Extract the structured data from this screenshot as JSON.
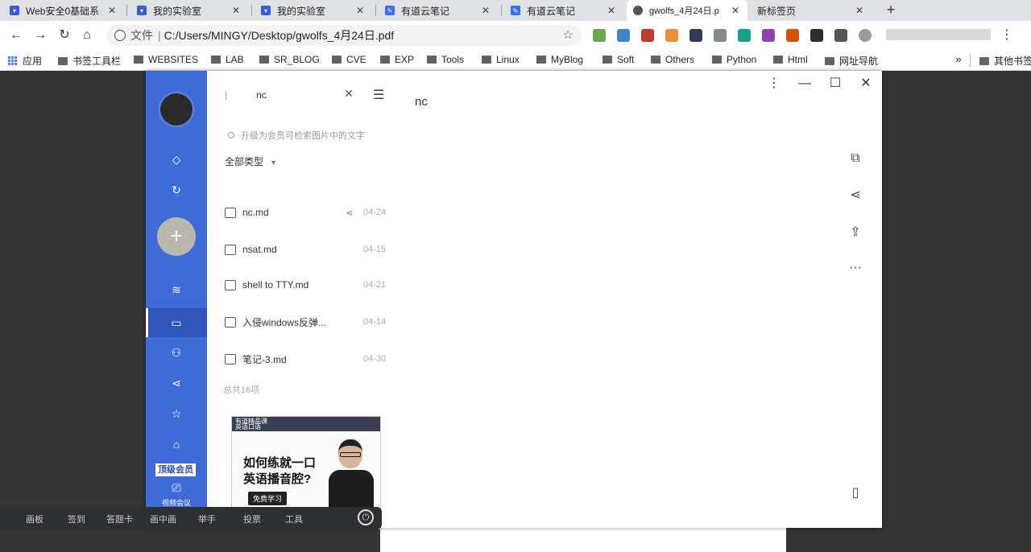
{
  "browser": {
    "tabs": [
      {
        "title": "Web安全0基础系",
        "favicon": "shield-icon",
        "color": "#3b5bd6"
      },
      {
        "title": "我的实验室",
        "favicon": "shield-icon",
        "color": "#3b5bd6"
      },
      {
        "title": "我的实验室",
        "favicon": "shield-icon",
        "color": "#3b5bd6"
      },
      {
        "title": "有道云笔记",
        "favicon": "note-icon",
        "color": "#3b6ff0"
      },
      {
        "title": "有道云笔记",
        "favicon": "note-icon",
        "color": "#3b6ff0"
      },
      {
        "title": "gwolfs_4月24日.p",
        "favicon": "globe-icon",
        "color": "#555555"
      },
      {
        "title": "新标签页",
        "favicon": "",
        "color": "#dee1e6"
      }
    ],
    "new_tab": "+",
    "address": {
      "prefix": "文件",
      "url": "C:/Users/MINGY/Desktop/gwolfs_4月24日.pdf"
    },
    "bookmarks": [
      {
        "label": "应用",
        "kind": "apps"
      },
      {
        "label": "书签工具栏",
        "kind": "folder"
      },
      {
        "label": "WEBSITES",
        "kind": "folder"
      },
      {
        "label": "LAB",
        "kind": "folder"
      },
      {
        "label": "SR_BLOG",
        "kind": "folder"
      },
      {
        "label": "CVE",
        "kind": "folder"
      },
      {
        "label": "EXP",
        "kind": "folder"
      },
      {
        "label": "Tools",
        "kind": "folder"
      },
      {
        "label": "Linux",
        "kind": "folder"
      },
      {
        "label": "MyBlog",
        "kind": "folder"
      },
      {
        "label": "Soft",
        "kind": "folder"
      },
      {
        "label": "Others",
        "kind": "folder"
      },
      {
        "label": "Python",
        "kind": "folder"
      },
      {
        "label": "Html",
        "kind": "folder"
      },
      {
        "label": "网址导航",
        "kind": "folder"
      },
      {
        "label": "其他书签",
        "kind": "folder"
      }
    ],
    "bookmarks_more": "»"
  },
  "app": {
    "search_value": "nc",
    "doc_title": "nc",
    "hint": "升级为会员可检索图片中的文字",
    "type_filter": "全部类型",
    "files": [
      {
        "name": "nc.md",
        "date": "04-24",
        "shared": true
      },
      {
        "name": "nsat.md",
        "date": "04-15",
        "shared": false
      },
      {
        "name": "shell to TTY.md",
        "date": "04-21",
        "shared": false
      },
      {
        "name": "入侵windows反弹...",
        "date": "04-14",
        "shared": false
      },
      {
        "name": "笔记-3.md",
        "date": "04-30",
        "shared": false
      }
    ],
    "total": "总共16项",
    "rail_badge": "顶级会员",
    "rail_meeting_label": "视频会议",
    "ad": {
      "header": "有道精品课",
      "sub": "英语口语",
      "line1": "如何练就一口",
      "line2": "英语播音腔?",
      "cta": "免费学习"
    }
  },
  "bottom_toolbar": [
    "画板",
    "签到",
    "答题卡",
    "画中画",
    "举手",
    "投票",
    "工具"
  ],
  "colors": {
    "rail": "#3e6bd6",
    "rail_active": "#2f56b8",
    "dark_bg": "#333436"
  }
}
